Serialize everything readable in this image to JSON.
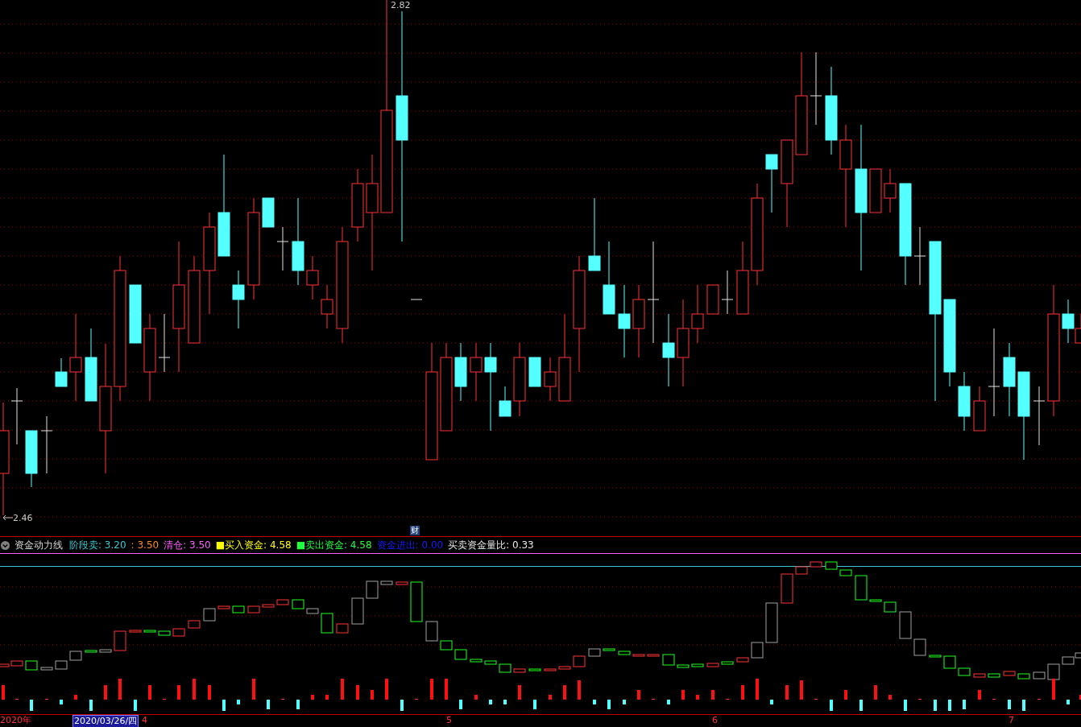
{
  "price_labels": {
    "high": "2.82",
    "low": "2.46"
  },
  "marker": {
    "text": "财"
  },
  "indicator": {
    "name": "资金动力线",
    "values": [
      {
        "label": "阶段卖: 3.20",
        "color": "#3cc8d0"
      },
      {
        "label": ": 3.50",
        "color": "#ff8c1a"
      },
      {
        "label": "清仓: 3.50",
        "color": "#ff60ff"
      },
      {
        "label": "■买入资金: 4.58",
        "color": "#ffff00"
      },
      {
        "label": "■卖出资金: 4.58",
        "color": "#20ff40"
      },
      {
        "label": "资金进出: 0.00",
        "color": "#1a1aff"
      },
      {
        "label": "买卖资金量比: 0.33",
        "color": "#e8e8e8"
      }
    ]
  },
  "time_axis": [
    {
      "label": "2020年",
      "kind": "year"
    },
    {
      "label": "2020/03/26/四",
      "kind": "cursor"
    },
    {
      "label": "4",
      "kind": "month"
    },
    {
      "label": "5",
      "kind": "month"
    },
    {
      "label": "6",
      "kind": "month"
    },
    {
      "label": "7",
      "kind": "month"
    }
  ]
}
